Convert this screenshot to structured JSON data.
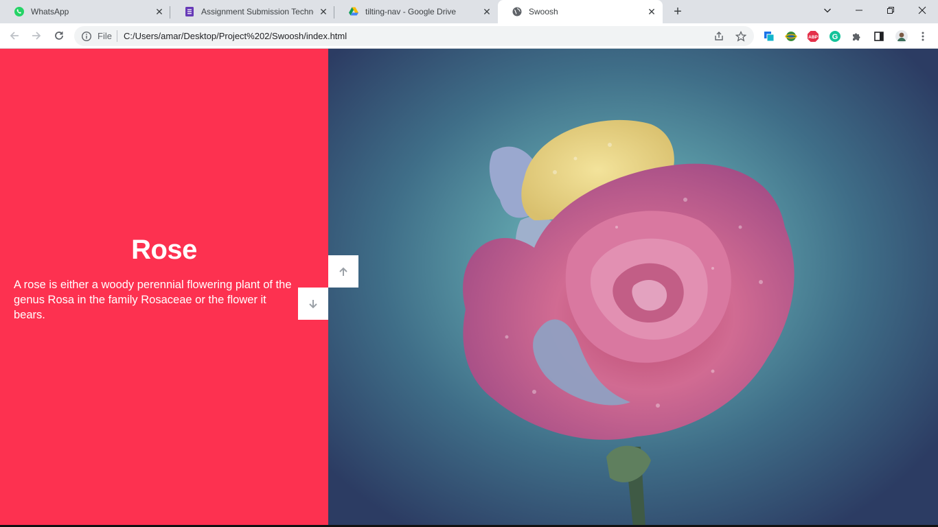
{
  "browser": {
    "tabs": [
      {
        "title": "WhatsApp",
        "icon": "whatsapp-icon",
        "active": false
      },
      {
        "title": "Assignment Submission Technetic",
        "icon": "google-forms-icon",
        "active": false
      },
      {
        "title": "tilting-nav - Google Drive",
        "icon": "google-drive-icon",
        "active": false
      },
      {
        "title": "Swoosh",
        "icon": "globe-icon",
        "active": true
      }
    ],
    "close_glyph": "✕",
    "new_tab_glyph": "+",
    "address": {
      "scheme_label": "File",
      "url": "C:/Users/amar/Desktop/Project%202/Swoosh/index.html"
    },
    "extensions": {
      "abp_label": "ABP",
      "grammarly_label": "G"
    }
  },
  "slide": {
    "title": "Rose",
    "description": "A rose is either a woody perennial flowering plant of the genus Rosa in the family Rosaceae or the flower it bears."
  },
  "colors": {
    "left_panel": "#fd3150",
    "button_bg": "#ffffff",
    "arrow": "#9aa0a6"
  }
}
